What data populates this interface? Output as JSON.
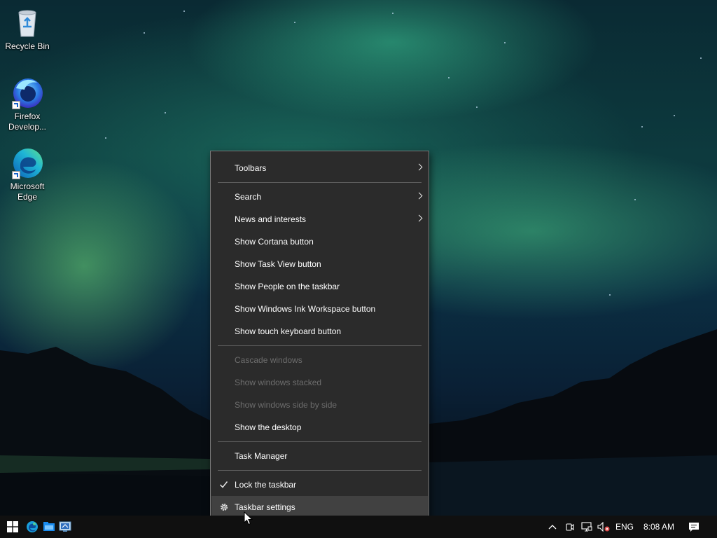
{
  "desktop_icons": [
    {
      "name": "recycle-bin",
      "label": "Recycle Bin",
      "icon": "recycle-bin-icon"
    },
    {
      "name": "firefox-developer",
      "label": "Firefox Develop...",
      "icon": "firefox-developer-icon"
    },
    {
      "name": "microsoft-edge",
      "label": "Microsoft Edge",
      "icon": "edge-icon"
    }
  ],
  "context_menu": {
    "toolbars": "Toolbars",
    "search": "Search",
    "news_and_interests": "News and interests",
    "show_cortana": "Show Cortana button",
    "show_task_view": "Show Task View button",
    "show_people": "Show People on the taskbar",
    "show_ink": "Show Windows Ink Workspace button",
    "show_touch_keyboard": "Show touch keyboard button",
    "cascade": "Cascade windows",
    "stacked": "Show windows stacked",
    "side_by_side": "Show windows side by side",
    "show_desktop": "Show the desktop",
    "task_manager": "Task Manager",
    "lock_taskbar": "Lock the taskbar",
    "taskbar_settings": "Taskbar settings"
  },
  "taskbar": {
    "language": "ENG",
    "clock": "8:08 AM"
  },
  "colors": {
    "menu_bg": "#2b2b2b",
    "menu_hover": "#414141",
    "menu_disabled_text": "#6d6d6d",
    "taskbar_bg": "#101010",
    "accent_blue": "#1a8cf0"
  }
}
